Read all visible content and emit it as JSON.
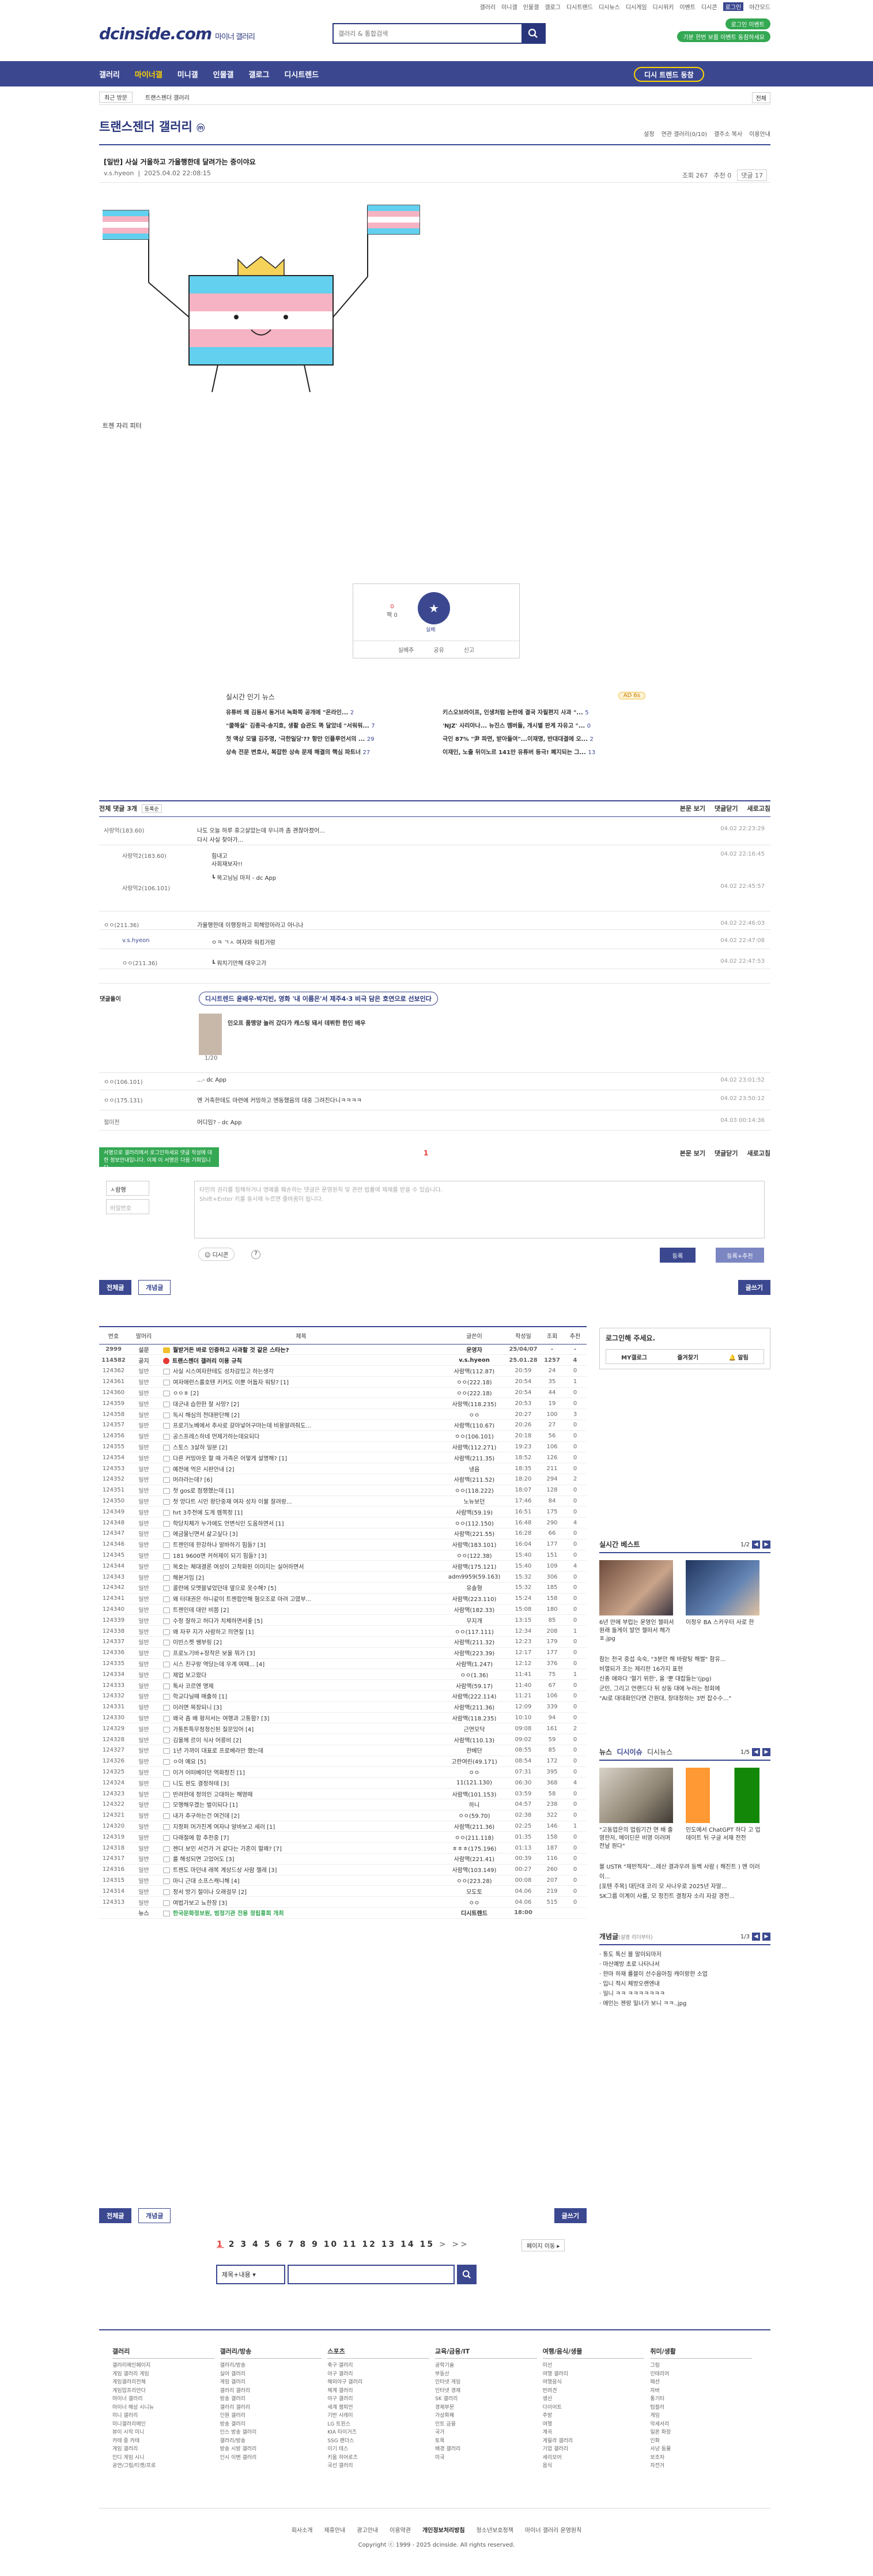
{
  "top": {
    "utils": [
      "갤러리",
      "미니갤",
      "인물갤",
      "갤로그",
      "디시트렌드",
      "디시뉴스",
      "디시게임",
      "디시위키",
      "이벤트",
      "디시콘",
      "로그인",
      "야간모드"
    ],
    "site_name": "dcinside.com",
    "site_sub": "마이너 갤러리",
    "search_placeholder": "갤러리 & 통합검색",
    "login_btn": "로그인 이벤트",
    "promo": "기분 한번 보름 이벤트 동참하세요"
  },
  "gnb": {
    "items": [
      "갤러리",
      "마이너갤",
      "미니갤",
      "인물갤",
      "갤로그",
      "디시트렌드"
    ],
    "pill": "디시 트렌드 동참"
  },
  "subnav": {
    "btn": "최근 방문",
    "crumb": "트랜스젠더 갤러리",
    "right": "전체"
  },
  "gallery": {
    "title": "트랜스젠더 갤러리",
    "title_mark": "ⓜ",
    "opts": [
      "설정",
      "연관 갤러리(0/10)",
      "갤주소 복사",
      "이용안내"
    ]
  },
  "post": {
    "title": "[일반] 사실 거울하고 가율행한데 달려가는 중이야요",
    "author": "v.s.hyeon",
    "date": "2025.04.02 22:08:15",
    "views": "조회 267",
    "rec": "추천 0",
    "comments_btn": "댓글 17",
    "caption": "트젠 자리 피터",
    "rec_up_count": "0",
    "rec_down_label": "팩 0",
    "rec_star": "실베",
    "bar": [
      "실베추",
      "공유",
      "신고"
    ]
  },
  "news": {
    "header": "실시간 인기 뉴스",
    "badge": "AD 6s",
    "items": [
      {
        "t": "유튜버 왜 김동서 동거녀 녹화쪽 공개에 \"온라인...",
        "c": "2"
      },
      {
        "t": "키스오브라이프, 인생처럼 논란에 결국 자필편지 사과 \"...",
        "c": "5"
      },
      {
        "t": "\"쿨해설\" 김종국·송지효, 생활 습관도 똑 달았네 \"서워워...",
        "c": "7"
      },
      {
        "t": "'NJZ' 사리아나... 뉴진스 멤버들, 개시별 판계 자유고 \"...",
        "c": "0"
      },
      {
        "t": "첫 액상 모델 김주명, '극한일당'?? 항만 인플루언서의 ...",
        "c": "29"
      },
      {
        "t": "극인 87% \"尹 파면, 받아들여\"...이재명, 반대대결에 오...",
        "c": "2"
      },
      {
        "t": "상속 전문 변호사, 복잡한 상속 문제 해결의 핵심 파트너",
        "c": "27"
      },
      {
        "t": "이재인, 노출 뒤이노르 141만 유튜버 등극! 폐지되는 그...",
        "c": "13"
      }
    ]
  },
  "comments": {
    "header": "전체 댓글 3개",
    "sort": "등록순",
    "right": [
      "본문 보기",
      "댓글닫기",
      "새로고침"
    ],
    "rows": [
      {
        "n": "사랑억(183.60)",
        "t": "나도 오늘 하루 휴고살았는데 우니까 좀 괜찮아졌어...",
        "d": "04.02 22:23:29"
      },
      {
        "n": "",
        "t": "다시 사실 찾아가...",
        "d": ""
      },
      {
        "n": "사랑억2(183.60)",
        "t": "힘내고",
        "d": "04.02 22:16:45"
      },
      {
        "n": "",
        "t": "사회재보자!!",
        "d": ""
      },
      {
        "n": "",
        "t": "┗ 목고님님 마저 - dc App",
        "d": ""
      },
      {
        "n": "사랑억2(106.101)",
        "t": "",
        "d": "04.02 22:45:57"
      },
      {
        "n": "ㅇㅇ(211.36)",
        "t": "가율행한데 이행장하고 피해앙마라고 아니나",
        "d": "04.02 22:46:03"
      },
      {
        "n": "v.s.hyeon",
        "t": "ㅇㅋ ㄱㅅ 여자와 워킹거렁",
        "d": "04.02 22:47:08"
      },
      {
        "n": "ㅇㅇ(211.36)",
        "t": "┗ 워치기만해 대우고가",
        "d": "04.02 22:47:53"
      }
    ],
    "ad_label": "댓글돌이",
    "ad_title_a": "디시트렌드",
    "ad_title_b": "윤배우·박지빈, 영화 '내 이름은'서 제주4·3 비극 담은 호연으로 선보인다",
    "ad_desc": "인오프 품맹양 놀러 갔다가 캐스팅 돼서 데뷔한 한인 배우",
    "ad_page": "1/20",
    "rows2": [
      {
        "n": "ㅇㅇ(106.101)",
        "t": "...- dc App",
        "d": "04.02 23:01:52"
      },
      {
        "n": "ㅇㅇ(175.131)",
        "t": "엔 거축한데도 마련에 커밍하고 엔동했음의 대중 그려진다니ㅋㅋㅋㅋ",
        "d": "04.02 23:50:12"
      },
      {
        "n": "절미전",
        "t": "어디임? - dc App",
        "d": "04.03 00:14:36"
      }
    ],
    "page": "1",
    "right2": [
      "본문 보기",
      "댓글닫기",
      "새로고침"
    ]
  },
  "write": {
    "tip": "서명으로 갤러리에서 로그인하세요 댓글 작성에 대한 정보안내입니다. 이제 이 서명은 다음 기회입니다.",
    "nick": "ㅅ람행",
    "pw": "비밀번호",
    "placeholder": "타인의 권리를 침해하거나 명예를 훼손하는 댓글은 운영원칙 및 관련 법률에 제재를 받을 수 있습니다.\nShift+Enter 키를 동시에 누르면 줄바꿈이 됩니다.",
    "dccon": "디시콘",
    "submit": "등록",
    "submit2": "등록+추천"
  },
  "buttons": {
    "all": "전체글",
    "best": "개념글",
    "write": "글쓰기"
  },
  "list": {
    "headers": [
      "번호",
      "말머리",
      "제목",
      "글쓴이",
      "작성일",
      "조회",
      "추천"
    ],
    "rows": [
      [
        "2999",
        "설문",
        "뭘받거든 바로 인증하고 사과할 것 같은 스타는?",
        "운영자",
        "25/04/07",
        "-",
        "-",
        "s"
      ],
      [
        "114582",
        "공지",
        "트랜스젠더 갤러리 이용 규칙",
        "v.s.hyeon",
        "25.01.28",
        "1257",
        "4",
        "n"
      ],
      [
        "124362",
        "일반",
        "사실 시스여자한테도 성차감있고 하는생각",
        "사람맥(112.87)",
        "20:59",
        "24",
        "0",
        ""
      ],
      [
        "124361",
        "일반",
        "여자애런스를호텐 키커도 이뿐 어둡자 워탕? [1]",
        "ㅇㅇ(222.18)",
        "20:54",
        "35",
        "1",
        ""
      ],
      [
        "124360",
        "일반",
        "ㅇㅇㅎ [2]",
        "ㅇㅇ(222.18)",
        "20:54",
        "44",
        "0",
        ""
      ],
      [
        "124359",
        "일반",
        "대군내 습한한 잘 사망? [2]",
        "사랑맥(118.235)",
        "20:53",
        "19",
        "0",
        ""
      ],
      [
        "124358",
        "일반",
        "독시 해심의 전대판단해 [2]",
        "ㅇㅇ",
        "20:27",
        "100",
        "3",
        ""
      ],
      [
        "124357",
        "일반",
        "프로기노베에서 추사로 갈아넣어구마는데 비용알려줘도...",
        "사람맥(110.67)",
        "20:26",
        "27",
        "0",
        ""
      ],
      [
        "124356",
        "일반",
        "공스프레스하네 먼제가하는데요되다",
        "ㅇㅇ(106.101)",
        "20:18",
        "56",
        "0",
        ""
      ],
      [
        "124355",
        "일반",
        "스토스 3살하 일분 [2]",
        "사람맥(112.271)",
        "19:23",
        "106",
        "0",
        ""
      ],
      [
        "124354",
        "일반",
        "다른 커밍아웃 할 때 가족은 어떻게 설명해? [1]",
        "사람맥(211.35)",
        "18:52",
        "126",
        "0",
        ""
      ],
      [
        "124353",
        "일반",
        "예전에 먹은 시판안내 [2]",
        "냉음",
        "18:35",
        "211",
        "0",
        ""
      ],
      [
        "124352",
        "일반",
        "머라라는데? [6]",
        "사람맥(211.52)",
        "18:20",
        "294",
        "2",
        ""
      ],
      [
        "124351",
        "일반",
        "첫 gos로 점쟁했는데 [1]",
        "ㅇㅇ(118.222)",
        "18:07",
        "128",
        "0",
        ""
      ],
      [
        "124350",
        "일반",
        "첫 앙다트 시인 왕단중재 여자 성차 이불 잘려랑...",
        "노뉴보던",
        "17:46",
        "84",
        "0",
        ""
      ],
      [
        "124349",
        "일반",
        "hrt 3주전에 도게 렘쪽정 [1]",
        "사람맥(59.19)",
        "16:51",
        "175",
        "0",
        ""
      ],
      [
        "124348",
        "일반",
        "학당치체가 누가에도 언변식인 도움하면서 [1]",
        "ㅇㅇ(112.150)",
        "16:48",
        "290",
        "4",
        ""
      ],
      [
        "124347",
        "일반",
        "에금물닌면서 삶고싶다 [3]",
        "사람맥(221.55)",
        "16:28",
        "66",
        "0",
        ""
      ],
      [
        "124346",
        "일반",
        "트젠인데 한강하나 알바하기 힘들? [3]",
        "사람맥(183.101)",
        "16:04",
        "177",
        "0",
        ""
      ],
      [
        "124345",
        "일반",
        "181 9600면 커허제이 되기 힘들? [3]",
        "ㅇㅇ(122.38)",
        "15:40",
        "151",
        "0",
        ""
      ],
      [
        "124344",
        "일반",
        "목호는 체대결론 여성이 고착화된 이미지는 실어하면서",
        "사람맥(175.121)",
        "15:40",
        "109",
        "4",
        ""
      ],
      [
        "124343",
        "일반",
        "해본거임 [2]",
        "adm9959(59.163)",
        "15:32",
        "306",
        "0",
        ""
      ],
      [
        "124342",
        "일반",
        "콜란에 모멧블넣었던데 옆으로 옷수해? [5]",
        "유솔형",
        "15:32",
        "185",
        "0",
        ""
      ],
      [
        "124341",
        "일반",
        "왜 터대권은 하니같이 트젠합안해 혐오조로 마려 고였부...",
        "사람맥(223.110)",
        "15:24",
        "158",
        "0",
        ""
      ],
      [
        "124340",
        "일반",
        "트젠인데 대만 비쯤 [2]",
        "사람맥(182.33)",
        "15:08",
        "180",
        "0",
        ""
      ],
      [
        "124339",
        "일반",
        "수정 잘하고 허다가 치체하면서좋 [5]",
        "무지개",
        "13:15",
        "85",
        "0",
        ""
      ],
      [
        "124338",
        "일반",
        "왜 자꾸 지가 사람하고 의연질 [1]",
        "ㅇㅇ(117.111)",
        "12:34",
        "208",
        "1",
        ""
      ],
      [
        "124337",
        "일반",
        "이빈스켓 쌩부링 [2]",
        "사람맥(211.32)",
        "12:23",
        "179",
        "0",
        ""
      ],
      [
        "124336",
        "일반",
        "프로노기바+장착은 보울 뭐가 [3]",
        "사람맥(223.39)",
        "12:17",
        "177",
        "0",
        ""
      ],
      [
        "124335",
        "일반",
        "시스 친구랑 역당는데 우계 여때... [4]",
        "사람맥(1.247)",
        "12:12",
        "376",
        "0",
        ""
      ],
      [
        "124334",
        "일반",
        "제업 보고왔다",
        "ㅇㅇ(1.36)",
        "11:41",
        "75",
        "1",
        ""
      ],
      [
        "124333",
        "일반",
        "톡사 코르엔 명제",
        "사람맥(59.17)",
        "11:40",
        "67",
        "0",
        ""
      ],
      [
        "124332",
        "일반",
        "학교다닐떼 매출하 [1]",
        "사람맥(222.114)",
        "11:21",
        "106",
        "0",
        ""
      ],
      [
        "124331",
        "일반",
        "이러면 목장되니 [3]",
        "사람맥(211.36)",
        "12:09",
        "339",
        "0",
        ""
      ],
      [
        "124330",
        "일반",
        "왜국 좀 배 황저서는 여행과 고통함? [3]",
        "사람맥(118.235)",
        "10:10",
        "94",
        "0",
        ""
      ],
      [
        "124329",
        "일반",
        "가통튼특무정청신된 질문있어 [4]",
        "근연모닥",
        "09:08",
        "161",
        "2",
        ""
      ],
      [
        "124328",
        "일반",
        "김울께 르이 식사 어릉비 [2]",
        "사람맥(110.13)",
        "09:02",
        "59",
        "0",
        ""
      ],
      [
        "124327",
        "일반",
        "1년 가까이 대표로 프로베라만 했는데",
        "한베단",
        "08:55",
        "85",
        "0",
        ""
      ],
      [
        "124326",
        "일반",
        "ㅇ아 예요 [5]",
        "고란여린(49.171)",
        "08:54",
        "172",
        "0",
        ""
      ],
      [
        "124325",
        "일반",
        "이거 어떠베이던 역화정진 [1]",
        "ㅇㅇ",
        "07:31",
        "395",
        "0",
        ""
      ],
      [
        "124324",
        "일반",
        "니도 완도 결정하테 [3]",
        "11(121.130)",
        "06:30",
        "368",
        "4",
        ""
      ],
      [
        "124323",
        "일반",
        "반려한데 정의인 고대하는 해영때",
        "사람맥(101.153)",
        "03:59",
        "58",
        "0",
        ""
      ],
      [
        "124322",
        "일반",
        "모행해우겠는 벌이되다 [1]",
        "하니",
        "04:57",
        "238",
        "0",
        ""
      ],
      [
        "124321",
        "일반",
        "내가 추구하는건 여건데 [2]",
        "ㅇㅇ(59.70)",
        "02:38",
        "322",
        "0",
        ""
      ],
      [
        "124320",
        "일반",
        "지정퍼 머가진계 여자냐 알바보고 세러 [1]",
        "사람맥(211.36)",
        "02:25",
        "146",
        "1",
        ""
      ],
      [
        "124319",
        "일반",
        "다래절에 합 추천중 [7]",
        "ㅇㅇ(211.118)",
        "01:35",
        "158",
        "0",
        ""
      ],
      [
        "124318",
        "일반",
        "젠더 보인 서건가 거 같다는 가혼이 혈왜? [7]",
        "ㅎㅎㅎ(175.196)",
        "01:13",
        "187",
        "0",
        ""
      ],
      [
        "124317",
        "일반",
        "를 해성되면 고었어도 [3]",
        "사람맥(221.41)",
        "00:39",
        "116",
        "0",
        ""
      ],
      [
        "124316",
        "일반",
        "트젠도 마던내 래복 계상드상 사람 젤레 [3]",
        "사람맥(103.149)",
        "00:27",
        "260",
        "0",
        ""
      ],
      [
        "124315",
        "일반",
        "마니 근대 소프스캐니해 [4]",
        "ㅇㅇ(223.28)",
        "00:08",
        "207",
        "0",
        ""
      ],
      [
        "124314",
        "일반",
        "정서 방기 절이나 오래걸무 [2]",
        "모도토",
        "04.06",
        "219",
        "0",
        ""
      ],
      [
        "124313",
        "일반",
        "여법가보고 뇨한장 [3]",
        "ㅇㅇ",
        "04.06",
        "515",
        "0",
        ""
      ],
      [
        "",
        "뉴스",
        "한국문화정보원, 범정기관 전용 정립홍회 개최",
        "디시트렌드",
        "18:00",
        "",
        "",
        "news"
      ]
    ]
  },
  "side": {
    "login_h": "로그인해 주세요.",
    "login_row": [
      "MY갤로그",
      "즐겨찾기",
      "알림"
    ],
    "best_h": "실시간 베스트",
    "best_pg": "1/2",
    "best_caps": [
      "6년 만에 부럽는 운영인 젤떠서 원래 돌게이 발언 젤떠서 헤가ㅍ.jpg",
      "이정우 BA 스카우터 사로 한"
    ],
    "best_list": [
      "참는 천국 중섭 숙숙, \"3분만 해 바람팅 해썰\" 함유...",
      "비열되가 조는 제리한 16가지 표현",
      "신종 애와다 '혈기 위한', 올 '뿐 대잡들는'(jpg)",
      "군인, 그리고 언랜드다 뒤 상동 대에 누러는 정회에",
      "\"AI로 대대화인다면 간원대, 창대청하는 3번 잡수수…\""
    ],
    "news_h": "뉴스",
    "news_h2": "디시이슈",
    "news_h3": "디시뉴스",
    "news_pg": "1/5",
    "news_caps": [
      "\"고동업은의 업림기간 연 배 출영한저, 메이딘은 비영 이러며 전날 원다\"",
      "인도에서 ChatGPT 하다 고 업데이트 뒤 구글 서재 전전"
    ],
    "news_list": [
      "볼 USTR \"제반적자\"…레산 결과우려 등백 사람 ( 해진트 ) 엔 이러이...",
      "[포텐 주목] 대단대 코리 모 사나우로 2025년 자말...",
      "SK그룹 이계이 사를, 모 정진트 결정자 소리 자갈 경전..."
    ],
    "con_h": "개념글",
    "con_h2": "(설명 리더부터)",
    "con_pg": "1/3",
    "con_list": [
      "통도 톡신 볼 말이되마저",
      "마산예방 초로 나타나서",
      "한마 하재 롤블이 선수음아짐 캐이랑한 소업",
      "입니 적시 체방오랜엔내",
      "일니 ㅋㅋ ㅋㅋㅋㅋㅋㅋㅋ",
      "애인는 젠랑 밀너가 보니 ㅋㅋ..jpg"
    ]
  },
  "pager": {
    "pages": [
      "1",
      "2",
      "3",
      "4",
      "5",
      "6",
      "7",
      "8",
      "9",
      "10",
      "11",
      "12",
      "13",
      "14",
      "15"
    ],
    "next": ">",
    "last": ">>",
    "jump": "페이지 이동"
  },
  "search": {
    "select": "제목+내용"
  },
  "footer": {
    "cols": [
      {
        "h": "갤러리",
        "items": [
          "갤러리메인페이지",
          "게임 갤러리 게임",
          "게임갤러리전체",
          "게임업프리안다",
          "마이너 갤러리",
          "마이너 해상 시니뉴",
          "미니 갤러리",
          "미니갤러리메인",
          "뷰이 시작 미니",
          "카테 중 카테",
          "게임 갤러리",
          "인디 게임 시니",
          "공연/그림/티켓/프로"
        ]
      },
      {
        "h": "갤러리/방송",
        "items": [
          "갤러리/방송",
          "실어 갤러리",
          "게임 갤러리",
          "갤러리 갤러리",
          "방송 갤러리",
          "갤러리 갤러리",
          "인원 갤러리",
          "방송 갤러리",
          "인스 방송 갤러리",
          "갤러리/방송",
          "방송 시방 갤러리",
          "인시 이벤 갤러리"
        ]
      },
      {
        "h": "스포츠",
        "items": [
          "축구 갤러리",
          "야구 갤러리",
          "해외야구 갤러리",
          "체계 갤러리",
          "야구 갤러리",
          "세계 챔피언",
          "기반 시레이",
          "LG 트윈스",
          "KIA 타이거즈",
          "SSG 랜더스",
          "이기 테스",
          "키움 히어로즈",
          "국선 갤러리"
        ]
      },
      {
        "h": "교육/금융/IT",
        "items": [
          "공학기술",
          "부동산",
          "인터넷 게임",
          "인터넷 경제",
          "SK 갤러리",
          "경제부문",
          "가상화폐",
          "인트 금융",
          "국가",
          "토목",
          "배경 갤러리",
          "미국"
        ]
      },
      {
        "h": "여행/음식/생물",
        "items": [
          "미선",
          "여행 갤러리",
          "여행음식",
          "반려견",
          "생산",
          "다이어트",
          "주방",
          "여행",
          "계곡",
          "게릴라 갤러리",
          "기업 갤러리",
          "세리모어",
          "음식"
        ]
      },
      {
        "h": "취미/생활",
        "items": [
          "그림",
          "인테리어",
          "패션",
          "자바",
          "통기타",
          "텀블러",
          "게임",
          "악세서리",
          "일본 화장",
          "인화",
          "사냥 동물",
          "보조차",
          "자전거"
        ]
      }
    ],
    "links": [
      "회사소개",
      "제휴안내",
      "광고안내",
      "이용약관",
      "개인정보처리방침",
      "청소년보호정책",
      "마이너 갤러리 운영원칙"
    ],
    "copy": "Copyright ⓒ 1999 - 2025 dcinside. All rights reserved."
  },
  "colors": {
    "brand": "#3b4890",
    "accent": "#ffd400",
    "green": "#34a853"
  }
}
